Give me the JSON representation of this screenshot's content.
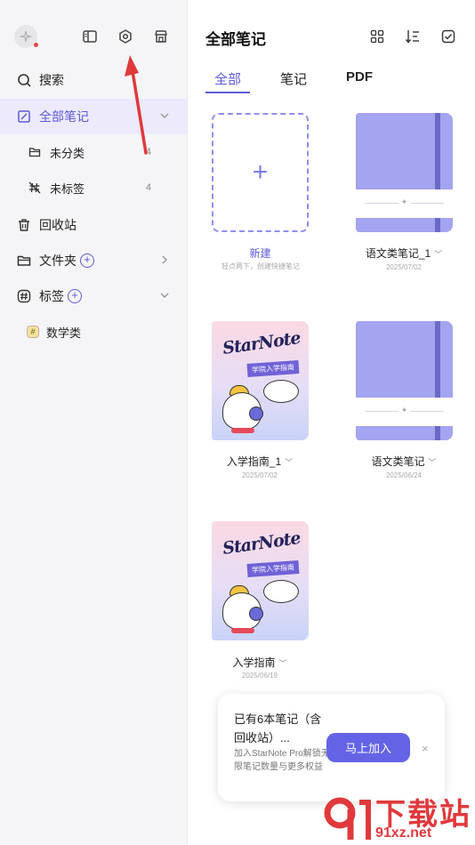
{
  "sidebar": {
    "search": "搜索",
    "all_notes": "全部笔记",
    "uncategorized": "未分类",
    "uncategorized_count": "4",
    "untagged": "未标签",
    "untagged_count": "4",
    "trash": "回收站",
    "folders": "文件夹",
    "tags": "标签",
    "tag_items": [
      {
        "label": "数学类",
        "badge": "#"
      }
    ]
  },
  "header": {
    "title": "全部笔记",
    "icons": [
      "grid-view-icon",
      "sort-icon",
      "select-icon"
    ]
  },
  "tabs": [
    {
      "label": "全部",
      "active": true
    },
    {
      "label": "笔记",
      "active": false
    },
    {
      "label": "PDF",
      "active": false
    }
  ],
  "new_note": {
    "label": "新建",
    "hint": "轻点两下，创建快捷笔记",
    "symbol": "+"
  },
  "notebooks": [
    {
      "title": "语文类笔记_1",
      "date": "2025/07/02",
      "cover": "plain"
    },
    {
      "title": "入学指南_1",
      "date": "2025/07/02",
      "cover": "guide"
    },
    {
      "title": "语文类笔记",
      "date": "2025/06/24",
      "cover": "plain"
    },
    {
      "title": "入学指南",
      "date": "2025/06/19",
      "cover": "guide"
    }
  ],
  "guide_cover": {
    "logo": "StarNote",
    "ribbon": "学院入学指南"
  },
  "promo": {
    "title": "已有6本笔记（含回收站）...",
    "desc": "加入StarNote Pro解锁无限笔记数量与更多权益",
    "button": "马上加入",
    "close": "×"
  },
  "watermark": {
    "text": "下载站",
    "url": "91xz.net"
  },
  "colors": {
    "accent": "#5b5bd6",
    "notebook": "#a4a4f0",
    "annotation": "#e0393c"
  }
}
